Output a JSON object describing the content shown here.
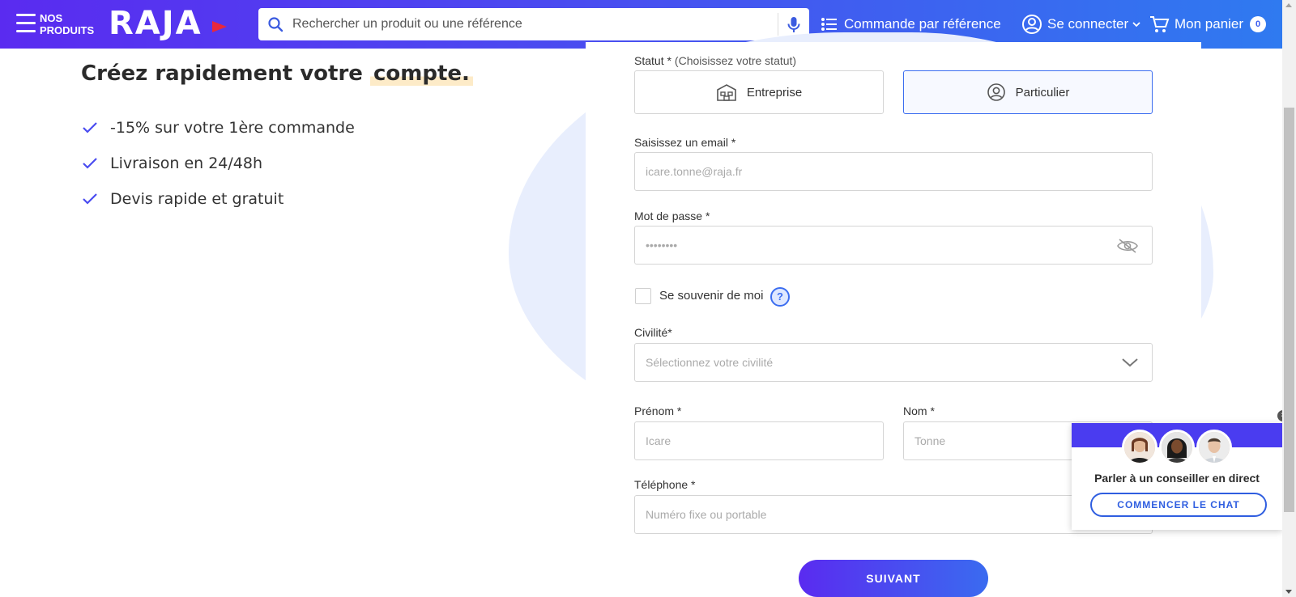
{
  "header": {
    "nos_line1": "NOS",
    "nos_line2": "PRODUITS",
    "logo_text": "RAJA",
    "search_placeholder": "Rechercher un produit ou une référence",
    "commande_label": "Commande par référence",
    "connect_label": "Se connecter",
    "cart_label": "Mon panier",
    "cart_count": "0"
  },
  "promo": {
    "headline_part1": "Créez rapidement votre",
    "headline_highlight": "compte.",
    "benefits": [
      "-15% sur votre 1ère commande",
      "Livraison en 24/48h",
      "Devis rapide et gratuit"
    ]
  },
  "form": {
    "status_label": "Statut *",
    "status_hint": "(Choisissez votre statut)",
    "status_options": [
      "Entreprise",
      "Particulier"
    ],
    "status_selected": "Particulier",
    "email_label": "Saisissez un email *",
    "email_placeholder": "icare.tonne@raja.fr",
    "password_label": "Mot de passe *",
    "password_placeholder": "••••••••",
    "remember_label": "Se souvenir de moi",
    "help_symbol": "?",
    "civility_label": "Civilité*",
    "civility_placeholder": "Sélectionnez votre civilité",
    "firstname_label": "Prénom *",
    "firstname_placeholder": "Icare",
    "lastname_label": "Nom *",
    "lastname_placeholder": "Tonne",
    "phone_label": "Téléphone *",
    "phone_placeholder": "Numéro fixe ou portable",
    "submit_label": "SUIVANT"
  },
  "chat": {
    "title": "Parler à un conseiller en direct",
    "button": "COMMENCER LE CHAT",
    "close_symbol": "×"
  },
  "colors": {
    "brand_purple": "#5a2bf0",
    "brand_blue": "#2f7af0",
    "accent_check": "#4a4cf0"
  }
}
